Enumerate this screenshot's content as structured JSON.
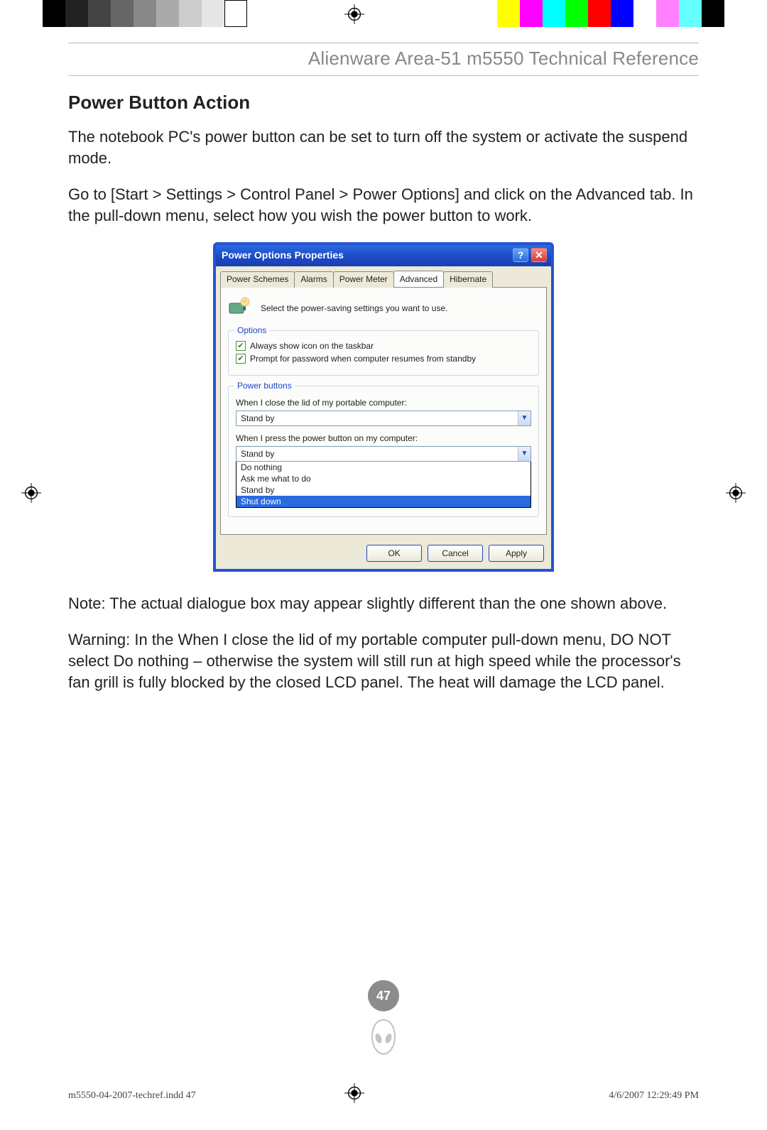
{
  "header": {
    "title": "Alienware Area-51 m5550 Technical Reference"
  },
  "section": {
    "title": "Power Button Action"
  },
  "paragraphs": {
    "p1": "The notebook PC's power button can be set to turn off the system or activate the suspend mode.",
    "p2": "Go to [Start > Settings > Control Panel > Power Options] and click on the Advanced tab. In the pull-down menu, select how you wish the power button to work.",
    "note": "Note: The actual dialogue box may appear slightly different than the one shown above.",
    "warning": "Warning: In the When I close the lid of my portable computer pull-down menu, DO NOT select Do nothing – otherwise the system will still run at high speed while the processor's fan grill is fully blocked by the closed LCD panel. The heat will damage the LCD panel."
  },
  "dialog": {
    "title": "Power Options Properties",
    "tabs": [
      "Power Schemes",
      "Alarms",
      "Power Meter",
      "Advanced",
      "Hibernate"
    ],
    "active_tab": "Advanced",
    "intro": "Select the power-saving settings you want to use.",
    "options_legend": "Options",
    "option1": "Always show icon on the taskbar",
    "option2": "Prompt for password when computer resumes from standby",
    "pb_legend": "Power buttons",
    "lid_label": "When I close the lid of my portable computer:",
    "lid_value": "Stand by",
    "power_label": "When I press the power button on my computer:",
    "power_value": "Stand by",
    "power_options": [
      "Do nothing",
      "Ask me what to do",
      "Stand by",
      "Shut down"
    ],
    "power_selected": "Shut down",
    "buttons": {
      "ok": "OK",
      "cancel": "Cancel",
      "apply": "Apply"
    }
  },
  "page_number": "47",
  "footer": {
    "left": "m5550-04-2007-techref.indd   47",
    "right": "4/6/2007   12:29:49 PM"
  }
}
